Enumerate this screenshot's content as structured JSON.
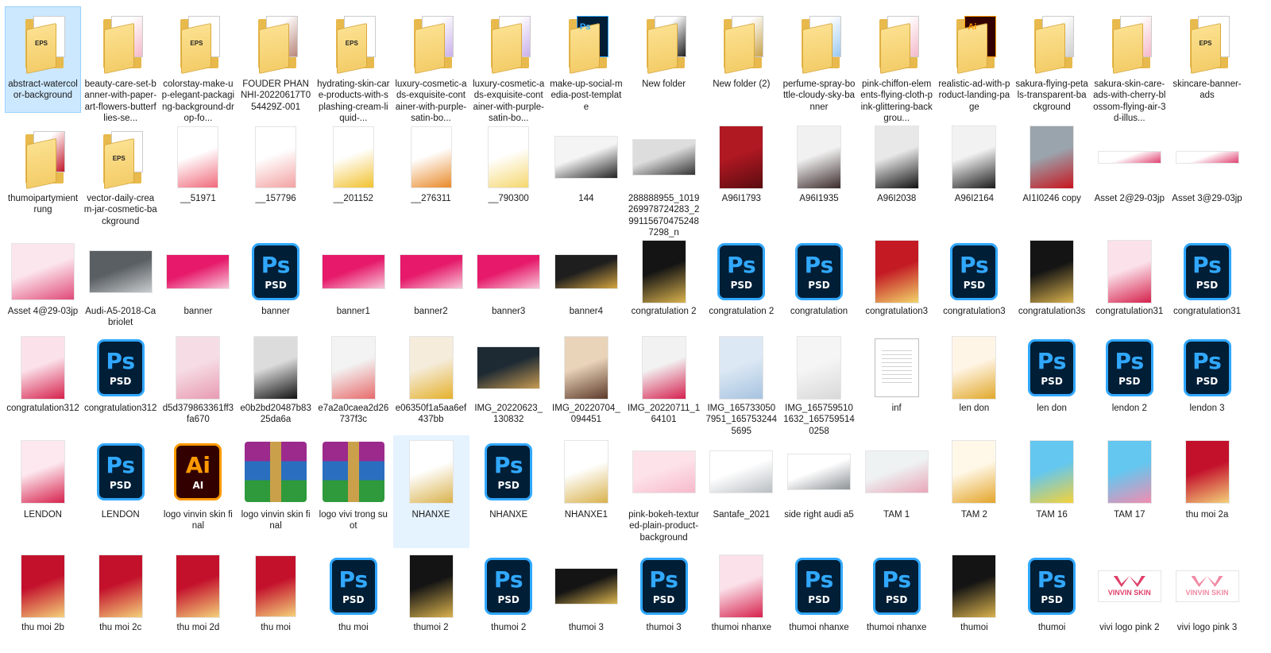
{
  "colors": {
    "selection_bg": "#cce8ff",
    "selection_border": "#99d1ff",
    "hover_bg": "#e5f3ff",
    "folder_yellow": "#f4cd69",
    "ps_blue": "#31a8ff",
    "ps_dark": "#001e36",
    "ai_orange": "#ff9a00"
  },
  "badges": {
    "psd": "PSD",
    "ps": "Ps",
    "ai_big": "Ai",
    "ai_small": "AI",
    "eps": "EPS",
    "folder_ai": "Ai"
  },
  "rows": [
    [
      {
        "name": "abstract-watercolor-background",
        "type": "folder",
        "preview": "eps",
        "selected": true
      },
      {
        "name": "beauty-care-set-banner-with-paper-art-flowers-butterflies-se...",
        "type": "folder",
        "preview": "pink"
      },
      {
        "name": "colorstay-make-up-elegant-packaging-background-drop-fo...",
        "type": "folder",
        "preview": "eps"
      },
      {
        "name": "FOUDER PHAN NHI-20220617T054429Z-001",
        "type": "folder",
        "preview": "portrait"
      },
      {
        "name": "hydrating-skin-care-products-with-splashing-cream-liquid-...",
        "type": "folder",
        "preview": "eps"
      },
      {
        "name": "luxury-cosmetic-ads-exquisite-container-with-purple-satin-bo...",
        "type": "folder",
        "preview": "purple"
      },
      {
        "name": "luxury-cosmetic-ads-exquisite-container-with-purple-satin-bo...",
        "type": "folder",
        "preview": "purple"
      },
      {
        "name": "make-up-social-media-post-template",
        "type": "folder",
        "preview": "ps"
      },
      {
        "name": "New folder",
        "type": "folder",
        "preview": "dark"
      },
      {
        "name": "New folder (2)",
        "type": "folder",
        "preview": "gold"
      },
      {
        "name": "perfume-spray-bottle-cloudy-sky-banner",
        "type": "folder",
        "preview": "blue"
      },
      {
        "name": "pink-chiffon-elements-flying-cloth-pink-glittering-backgrou...",
        "type": "folder",
        "preview": "pink"
      },
      {
        "name": "realistic-ad-with-product-landing-page",
        "type": "folder",
        "preview": "ai"
      },
      {
        "name": "sakura-flying-petals-transparent-background",
        "type": "folder",
        "preview": "gray"
      },
      {
        "name": "sakura-skin-care-ads-with-cherry-blossom-flying-air-3d-illus...",
        "type": "folder",
        "preview": "pink"
      },
      {
        "name": "skincare-banner-ads",
        "type": "folder",
        "preview": "eps"
      }
    ],
    [
      {
        "name": "thumoipartymientrung",
        "type": "folder",
        "preview": "red"
      },
      {
        "name": "vector-daily-cream-jar-cosmetic-background",
        "type": "folder",
        "preview": "eps"
      },
      {
        "name": "__51971",
        "type": "image",
        "shape": "tall-sm",
        "c1": "#ffffff",
        "c2": "#f06a7b"
      },
      {
        "name": "__157796",
        "type": "image",
        "shape": "tall-sm",
        "c1": "#ffffff",
        "c2": "#f3a2a2"
      },
      {
        "name": "__201152",
        "type": "image",
        "shape": "tall-sm",
        "c1": "#ffffff",
        "c2": "#f2c230"
      },
      {
        "name": "__276311",
        "type": "image",
        "shape": "tall-sm",
        "c1": "#ffffff",
        "c2": "#e98a2a"
      },
      {
        "name": "__790300",
        "type": "image",
        "shape": "tall-sm",
        "c1": "#ffffff",
        "c2": "#f5d76e"
      },
      {
        "name": "144",
        "type": "image",
        "shape": "wide",
        "c1": "#f4f4f4",
        "c2": "#222222"
      },
      {
        "name": "288888955_1019269978724283_299115670475248 7298_n",
        "type": "image",
        "shape": "wide-sm",
        "c1": "#dddddd",
        "c2": "#333333"
      },
      {
        "name": "A96I1793",
        "type": "image",
        "shape": "tall",
        "c1": "#b01822",
        "c2": "#5a0c10"
      },
      {
        "name": "A96I1935",
        "type": "image",
        "shape": "tall",
        "c1": "#f1f1f1",
        "c2": "#3b2a2a"
      },
      {
        "name": "A96I2038",
        "type": "image",
        "shape": "tall",
        "c1": "#e8e8e8",
        "c2": "#111111"
      },
      {
        "name": "A96I2164",
        "type": "image",
        "shape": "tall",
        "c1": "#f2f2f2",
        "c2": "#1b1b1b"
      },
      {
        "name": "AI1I0246 copy",
        "type": "image",
        "shape": "tall",
        "c1": "#9aa4ad",
        "c2": "#c8151e"
      },
      {
        "name": "Asset 2@29-03jp",
        "type": "image",
        "shape": "strip",
        "c1": "#ffffff",
        "c2": "#e04070"
      },
      {
        "name": "Asset 3@29-03jp",
        "type": "image",
        "shape": "strip",
        "c1": "#ffffff",
        "c2": "#e04070"
      }
    ],
    [
      {
        "name": "Asset 4@29-03jp",
        "type": "image",
        "shape": "square",
        "c1": "#fce6ee",
        "c2": "#e04a78"
      },
      {
        "name": "Audi-A5-2018-Cabriolet",
        "type": "image",
        "shape": "wide",
        "c1": "#5a5f63",
        "c2": "#c9cdd0"
      },
      {
        "name": "banner",
        "type": "image",
        "shape": "banner",
        "c1": "#e6196a",
        "c2": "#f7c6d8"
      },
      {
        "name": "banner",
        "type": "ps"
      },
      {
        "name": "banner1",
        "type": "image",
        "shape": "banner",
        "c1": "#e6196a",
        "c2": "#f7c6d8"
      },
      {
        "name": "banner2",
        "type": "image",
        "shape": "banner",
        "c1": "#e6196a",
        "c2": "#f7c6d8"
      },
      {
        "name": "banner3",
        "type": "image",
        "shape": "banner",
        "c1": "#e6196a",
        "c2": "#f7c6d8"
      },
      {
        "name": "banner4",
        "type": "image",
        "shape": "banner",
        "c1": "#1e1e1e",
        "c2": "#d4a540"
      },
      {
        "name": "congratulation 2",
        "type": "image",
        "shape": "tall",
        "c1": "#141414",
        "c2": "#d9b24d"
      },
      {
        "name": "congratulation 2",
        "type": "ps"
      },
      {
        "name": "congratulation",
        "type": "ps"
      },
      {
        "name": "congratulation3",
        "type": "image",
        "shape": "tall",
        "c1": "#c31a24",
        "c2": "#f2d56a"
      },
      {
        "name": "congratulation3",
        "type": "ps"
      },
      {
        "name": "congratulation3s",
        "type": "image",
        "shape": "tall",
        "c1": "#141414",
        "c2": "#d9b24d"
      },
      {
        "name": "congratulation31",
        "type": "image",
        "shape": "tall",
        "c1": "#fbe1ea",
        "c2": "#d6224d"
      },
      {
        "name": "congratulation31",
        "type": "ps"
      }
    ],
    [
      {
        "name": "congratulation312",
        "type": "image",
        "shape": "tall",
        "c1": "#fbe1ea",
        "c2": "#d6224d"
      },
      {
        "name": "congratulation312",
        "type": "ps"
      },
      {
        "name": "d5d379863361ff3fa670",
        "type": "image",
        "shape": "tall",
        "c1": "#f6dde5",
        "c2": "#e89bb3"
      },
      {
        "name": "e0b2bd20487b8325da6a",
        "type": "image",
        "shape": "tall",
        "c1": "#dcdcdc",
        "c2": "#111111"
      },
      {
        "name": "e7a2a0caea2d26737f3c",
        "type": "image",
        "shape": "tall",
        "c1": "#f3f3f3",
        "c2": "#e86b6b"
      },
      {
        "name": "e06350f1a5aa6ef437bb",
        "type": "image",
        "shape": "tall",
        "c1": "#f5ecdc",
        "c2": "#e5b12c"
      },
      {
        "name": "IMG_20220623_130832",
        "type": "image",
        "shape": "wide",
        "c1": "#1e2a33",
        "c2": "#c79b52"
      },
      {
        "name": "IMG_20220704_094451",
        "type": "image",
        "shape": "tall",
        "c1": "#e9d3b9",
        "c2": "#5d3a2a"
      },
      {
        "name": "IMG_20220711_164101",
        "type": "image",
        "shape": "tall",
        "c1": "#f2f2f2",
        "c2": "#d6204f"
      },
      {
        "name": "IMG_1657330507951_1657532445695",
        "type": "image",
        "shape": "tall",
        "c1": "#dce8f4",
        "c2": "#a7c3e0"
      },
      {
        "name": "IMG_1657595101632_1657595140258",
        "type": "image",
        "shape": "tall",
        "c1": "#f5f5f5",
        "c2": "#d8d8d8"
      },
      {
        "name": "inf",
        "type": "doc"
      },
      {
        "name": "len don",
        "type": "image",
        "shape": "tall",
        "c1": "#fff5e6",
        "c2": "#e1a92c"
      },
      {
        "name": "len don",
        "type": "ps"
      },
      {
        "name": "lendon 2",
        "type": "ps"
      },
      {
        "name": "lendon 3",
        "type": "ps"
      }
    ],
    [
      {
        "name": "LENDON",
        "type": "image",
        "shape": "tall",
        "c1": "#fde8ef",
        "c2": "#d6224d"
      },
      {
        "name": "LENDON",
        "type": "ps"
      },
      {
        "name": "logo vinvin skin final",
        "type": "ai"
      },
      {
        "name": "logo vinvin skin final",
        "type": "winrar"
      },
      {
        "name": "logo vivi trong suot",
        "type": "winrar"
      },
      {
        "name": "NHANXE",
        "type": "image",
        "shape": "tall",
        "c1": "#ffffff",
        "c2": "#d9b24d",
        "hovered": true
      },
      {
        "name": "NHANXE",
        "type": "ps"
      },
      {
        "name": "NHANXE1",
        "type": "image",
        "shape": "tall",
        "c1": "#ffffff",
        "c2": "#d9b24d"
      },
      {
        "name": "pink-bokeh-textured-plain-product-background",
        "type": "image",
        "shape": "wide",
        "c1": "#fde2ea",
        "c2": "#f7b9cb"
      },
      {
        "name": "Santafe_2021",
        "type": "image",
        "shape": "wide",
        "c1": "#ffffff",
        "c2": "#b9bec2"
      },
      {
        "name": "side right audi a5",
        "type": "image",
        "shape": "wide-sm",
        "c1": "#ffffff",
        "c2": "#8e9397"
      },
      {
        "name": "TAM 1",
        "type": "image",
        "shape": "wide",
        "c1": "#eef2f3",
        "c2": "#e8a6b8"
      },
      {
        "name": "TAM 2",
        "type": "image",
        "shape": "tall",
        "c1": "#fff8e8",
        "c2": "#e4a52a"
      },
      {
        "name": "TAM 16",
        "type": "image",
        "shape": "tall",
        "c1": "#63c7f0",
        "c2": "#f4d23a"
      },
      {
        "name": "TAM 17",
        "type": "image",
        "shape": "tall",
        "c1": "#63c7f0",
        "c2": "#f28cb0"
      },
      {
        "name": "thu moi 2a",
        "type": "image",
        "shape": "tall",
        "c1": "#c3112c",
        "c2": "#f4d17a"
      }
    ],
    [
      {
        "name": "thu moi 2b",
        "type": "image",
        "shape": "tall",
        "c1": "#c3112c",
        "c2": "#f4d17a"
      },
      {
        "name": "thu moi 2c",
        "type": "image",
        "shape": "tall",
        "c1": "#c3112c",
        "c2": "#f4d17a"
      },
      {
        "name": "thu moi 2d",
        "type": "image",
        "shape": "tall",
        "c1": "#c3112c",
        "c2": "#f4d17a"
      },
      {
        "name": "thu moi",
        "type": "image",
        "shape": "tall-sm",
        "c1": "#c3112c",
        "c2": "#f4d17a"
      },
      {
        "name": "thu moi",
        "type": "ps"
      },
      {
        "name": "thumoi 2",
        "type": "image",
        "shape": "tall",
        "c1": "#141414",
        "c2": "#d9b24d"
      },
      {
        "name": "thumoi 2",
        "type": "ps"
      },
      {
        "name": "thumoi 3",
        "type": "image",
        "shape": "wide-sm",
        "c1": "#141414",
        "c2": "#d9b24d"
      },
      {
        "name": "thumoi 3",
        "type": "ps"
      },
      {
        "name": "thumoi nhanxe",
        "type": "image",
        "shape": "tall",
        "c1": "#fbe1ea",
        "c2": "#d6224d"
      },
      {
        "name": "thumoi nhanxe",
        "type": "ps"
      },
      {
        "name": "thumoi nhanxe",
        "type": "ps"
      },
      {
        "name": "thumoi",
        "type": "image",
        "shape": "tall",
        "c1": "#141414",
        "c2": "#d9b24d"
      },
      {
        "name": "thumoi",
        "type": "ps"
      },
      {
        "name": "vivi logo pink 2",
        "type": "logo",
        "c1": "#ffffff",
        "c2": "#e0406a",
        "text": "VINVIN SKIN"
      },
      {
        "name": "vivi logo pink 3",
        "type": "logo",
        "c1": "#ffffff",
        "c2": "#f08aa4",
        "text": "VINVIN SKIN"
      }
    ]
  ]
}
